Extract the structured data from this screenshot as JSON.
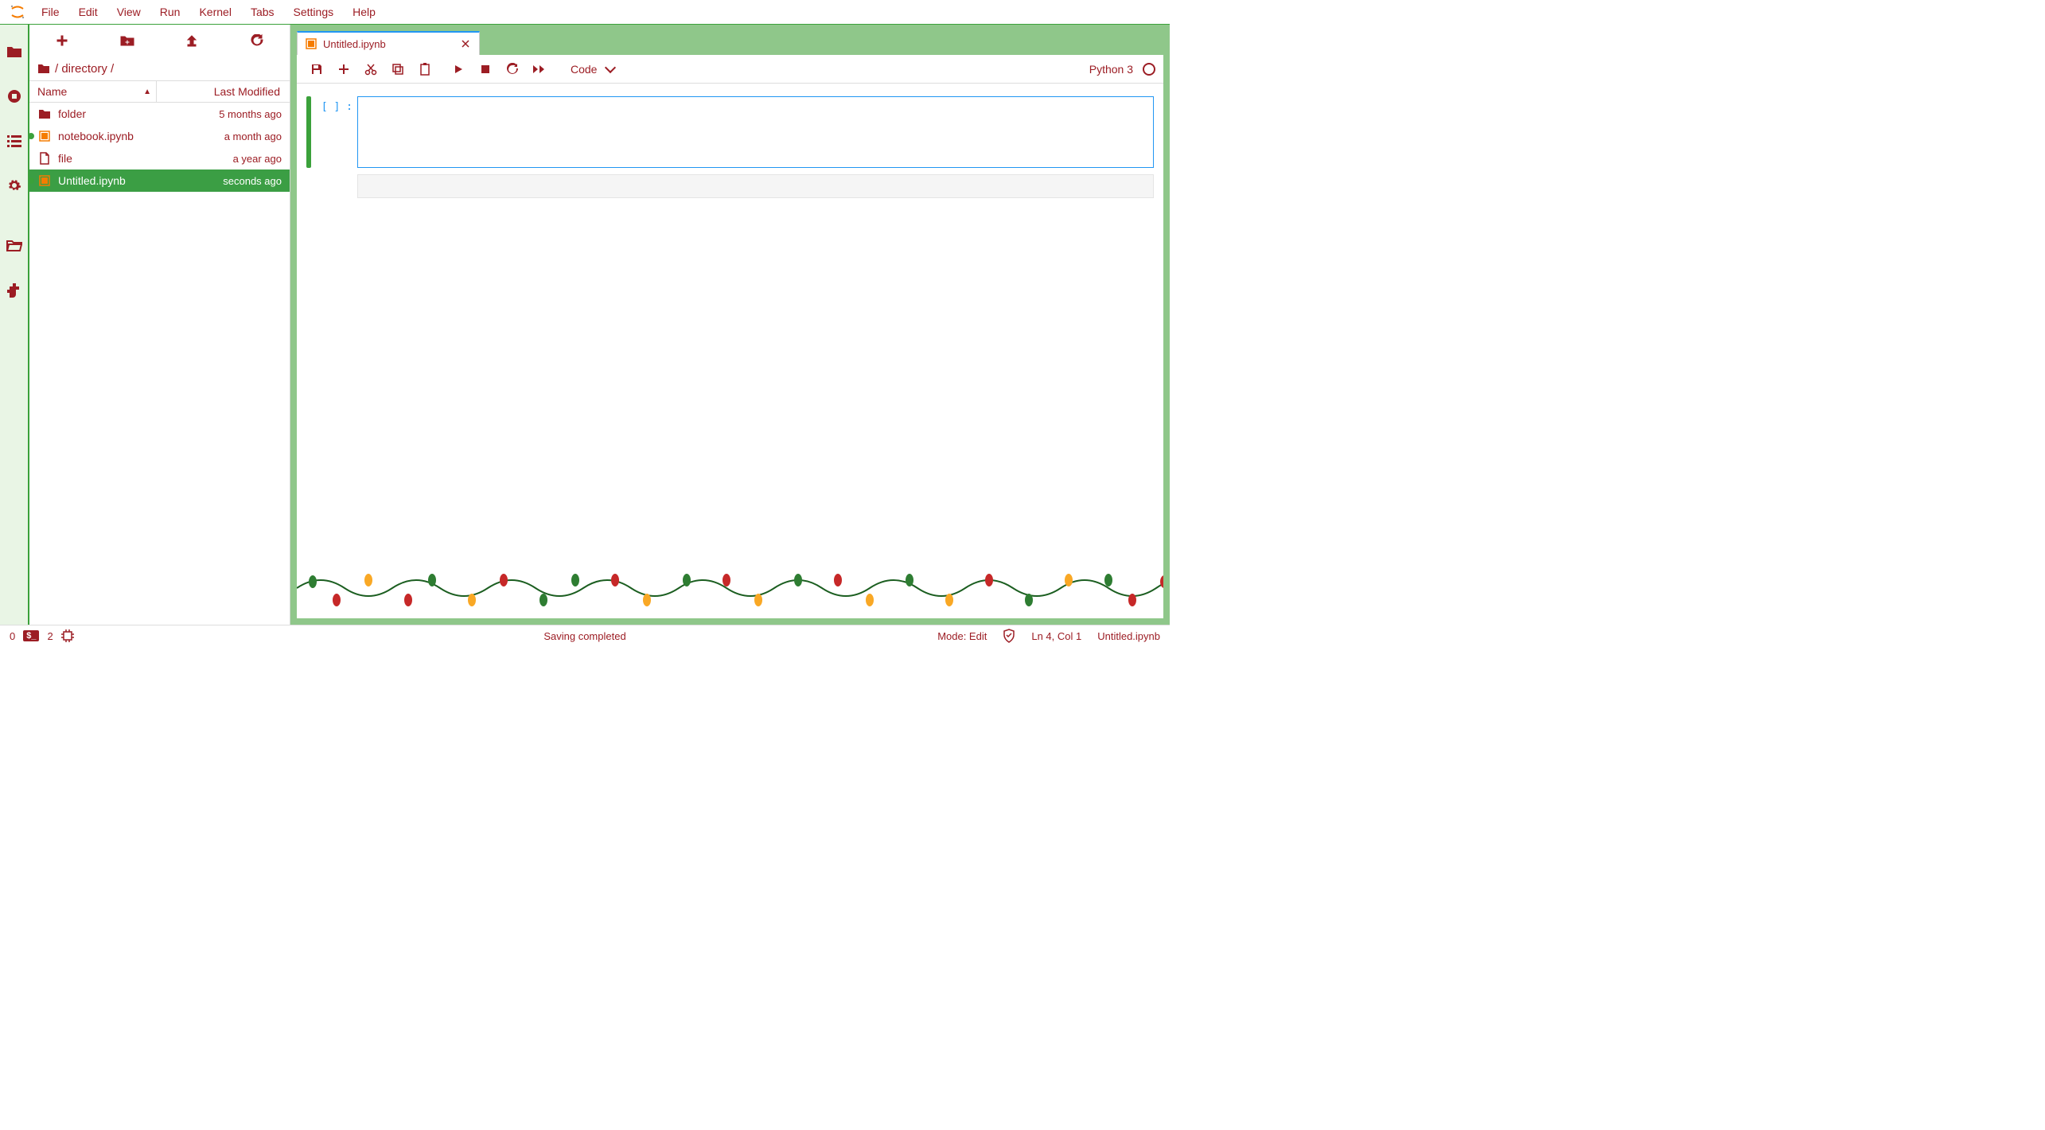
{
  "menu": {
    "items": [
      "File",
      "Edit",
      "View",
      "Run",
      "Kernel",
      "Tabs",
      "Settings",
      "Help"
    ]
  },
  "sidebar_toolbar": {
    "new": "+",
    "new_folder": "new-folder",
    "upload": "upload",
    "refresh": "refresh"
  },
  "breadcrumb": {
    "path": "/ directory /"
  },
  "columns": {
    "name": "Name",
    "modified": "Last Modified"
  },
  "files": [
    {
      "icon": "folder",
      "name": "folder",
      "modified": "5 months ago",
      "running": false,
      "selected": false
    },
    {
      "icon": "notebook",
      "name": "notebook.ipynb",
      "modified": "a month ago",
      "running": true,
      "selected": false
    },
    {
      "icon": "file",
      "name": "file",
      "modified": "a year ago",
      "running": false,
      "selected": false
    },
    {
      "icon": "notebook",
      "name": "Untitled.ipynb",
      "modified": "seconds ago",
      "running": true,
      "selected": true
    }
  ],
  "tab": {
    "title": "Untitled.ipynb"
  },
  "nbtoolbar": {
    "celltype": "Code",
    "kernel": "Python 3"
  },
  "cell": {
    "prompt": "[   ] :"
  },
  "statusbar": {
    "left_count1": "0",
    "terminal_badge": "$_",
    "left_count2": "2",
    "saving": "Saving completed",
    "mode": "Mode: Edit",
    "lncol": "Ln 4, Col 1",
    "filename": "Untitled.ipynb"
  }
}
